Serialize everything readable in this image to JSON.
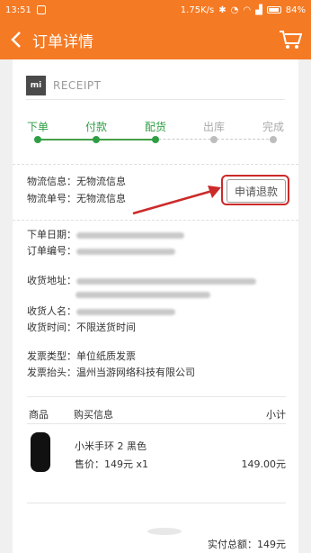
{
  "status_bar": {
    "time": "13:51",
    "speed": "1.75K/s",
    "battery_percent": "84%"
  },
  "app_bar": {
    "title": "订单详情"
  },
  "receipt": {
    "brand_mark": "mi",
    "label": "RECEIPT"
  },
  "progress": {
    "steps": [
      {
        "label": "下单",
        "done": true
      },
      {
        "label": "付款",
        "done": true
      },
      {
        "label": "配货",
        "done": true
      },
      {
        "label": "出库",
        "done": false
      },
      {
        "label": "完成",
        "done": false
      }
    ]
  },
  "logistics": {
    "info_label": "物流信息：",
    "info_value": "无物流信息",
    "number_label": "物流单号：",
    "number_value": "无物流信息",
    "refund_button": "申请退款"
  },
  "order": {
    "date_label": "下单日期：",
    "number_label": "订单编号："
  },
  "shipping": {
    "address_label": "收货地址：",
    "name_label": "收货人名：",
    "time_label": "收货时间：",
    "time_value": "不限送货时间"
  },
  "invoice": {
    "type_label": "发票类型：",
    "type_value": "单位纸质发票",
    "title_label": "发票抬头：",
    "title_value": "温州当游网络科技有限公司"
  },
  "items_table": {
    "headers": [
      "商品",
      "购买信息",
      "小计"
    ],
    "rows": [
      {
        "name": "小米手环 2 黑色",
        "price": "售价：149元 x1",
        "subtotal": "149.00元"
      }
    ]
  },
  "total": {
    "text": "实付总额：149元"
  },
  "colors": {
    "accent": "#f57a24",
    "done": "#2e9e44",
    "highlight": "#cc2a2a"
  }
}
